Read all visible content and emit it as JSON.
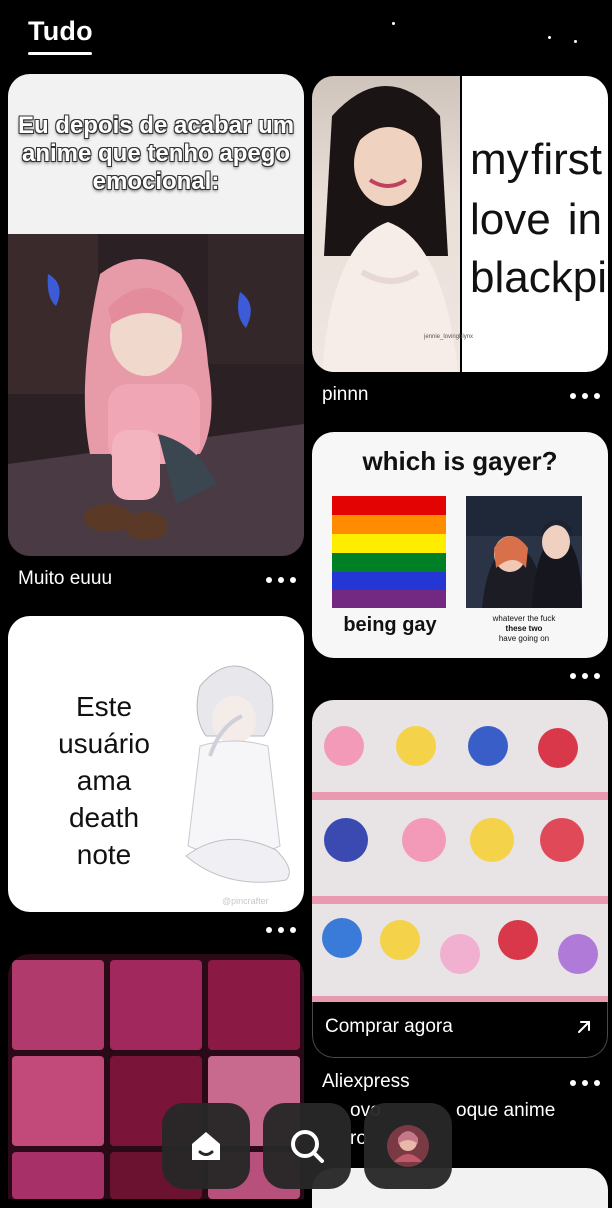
{
  "header": {
    "tab_label": "Tudo"
  },
  "pins": {
    "anime_meme": {
      "overlay_text": "Eu depois de acabar um anime que tenho apego emocional:",
      "caption": "Muito euuu"
    },
    "blackpink": {
      "line1_a": "my",
      "line1_b": "first",
      "line2_a": "love",
      "line2_b": "in",
      "line3": "blackpink",
      "watermark": "jennie_lovingblynx",
      "caption": "pinnn"
    },
    "gayer_meme": {
      "title": "which is gayer?",
      "left_label": "being gay",
      "right_label_1": "whatever the fuck",
      "right_label_2": "these two",
      "right_label_3": "have going on"
    },
    "death_note": {
      "line1": "Este",
      "line2": "usuário",
      "line3": "ama",
      "line4": "death note",
      "watermark": "@pincrafter"
    },
    "figures": {
      "cta": "Comprar agora",
      "advertiser": "Aliexpress",
      "description": "Novo estoque anime",
      "description_visible": "ovo",
      "description_visible_2": "oque anime",
      "desc_line2_visible": "ro"
    }
  },
  "colors": {
    "background": "#000000",
    "card_text": "#111111",
    "nav_button": "#282828"
  },
  "nav": {
    "home_icon": "home-icon",
    "search_icon": "search-icon",
    "profile_icon": "avatar"
  }
}
